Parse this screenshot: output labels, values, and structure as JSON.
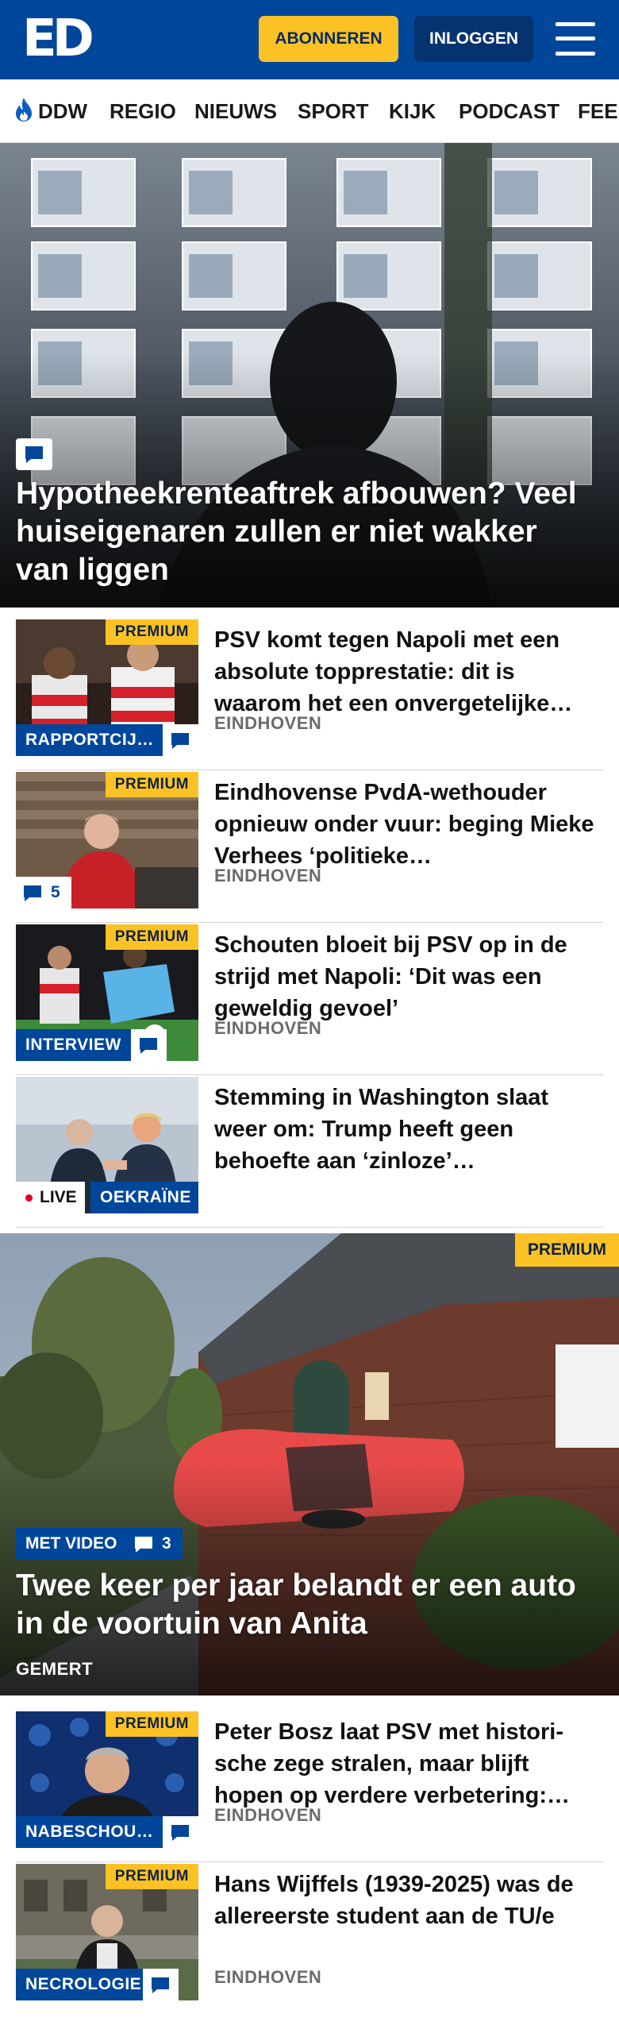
{
  "header": {
    "logo": "ED",
    "subscribe_label": "ABONNEREN",
    "login_label": "INLOGGEN",
    "menu_icon": "hamburger-menu-icon",
    "brand_color": "#00479b",
    "accent_color": "#fcc225"
  },
  "nav": {
    "items": [
      {
        "label": "DDW",
        "icon": "flame-icon"
      },
      {
        "label": "REGIO"
      },
      {
        "label": "NIEUWS"
      },
      {
        "label": "SPORT"
      },
      {
        "label": "KIJK"
      },
      {
        "label": "PODCAST"
      },
      {
        "label": "FEE"
      }
    ]
  },
  "hero": {
    "title": "Hypotheekrenteaftrek afbouwen? Veel huiseigenaren zullen er niet wakker van liggen",
    "icon": "comment-icon"
  },
  "articles": [
    {
      "title": "PSV komt tegen Napoli met een absolute toppresta­tie: dit is waarom het een onvergetelijke…",
      "location": "EINDHOVEN",
      "premium": "PREMIUM",
      "tag": "RAPPORTCIJ…",
      "comments": ""
    },
    {
      "title": "Eindhovense PvdA-wethouder opnieuw onder vuur: beging Mieke Verhees ‘politieke…",
      "location": "EINDHOVEN",
      "premium": "PREMIUM",
      "tag": "",
      "comments": "5"
    },
    {
      "title": "Schouten bloeit bij PSV op in de strijd met Napoli: ‘Dit was een geweldig gevoel’",
      "location": "EINDHOVEN",
      "premium": "PREMIUM",
      "tag": "INTERVIEW",
      "comments": ""
    },
    {
      "title": "Stemming in Washington slaat weer om: Trump heeft geen behoefte aan ‘zinloze’…",
      "location": "",
      "premium": "",
      "tag": "OEKRAÏNE",
      "live": "LIVE",
      "comments": ""
    }
  ],
  "feature": {
    "premium": "PREMIUM",
    "video_tag": "MET VIDEO",
    "comments": "3",
    "title": "Twee keer per jaar belandt er een auto in de voortuin van Anita",
    "location": "GEMERT"
  },
  "articles2": [
    {
      "title": "Peter Bosz laat PSV met histori­sche zege stralen, maar blijft hopen op verdere verbetering:…",
      "location": "EINDHOVEN",
      "premium": "PREMIUM",
      "tag": "NABESCHOU…"
    },
    {
      "title": "Hans Wijffels (1939-2025) was de allereerste student aan de TU/e",
      "location": "EINDHOVEN",
      "premium": "PREMIUM",
      "tag": "NECROLOGIE"
    }
  ]
}
